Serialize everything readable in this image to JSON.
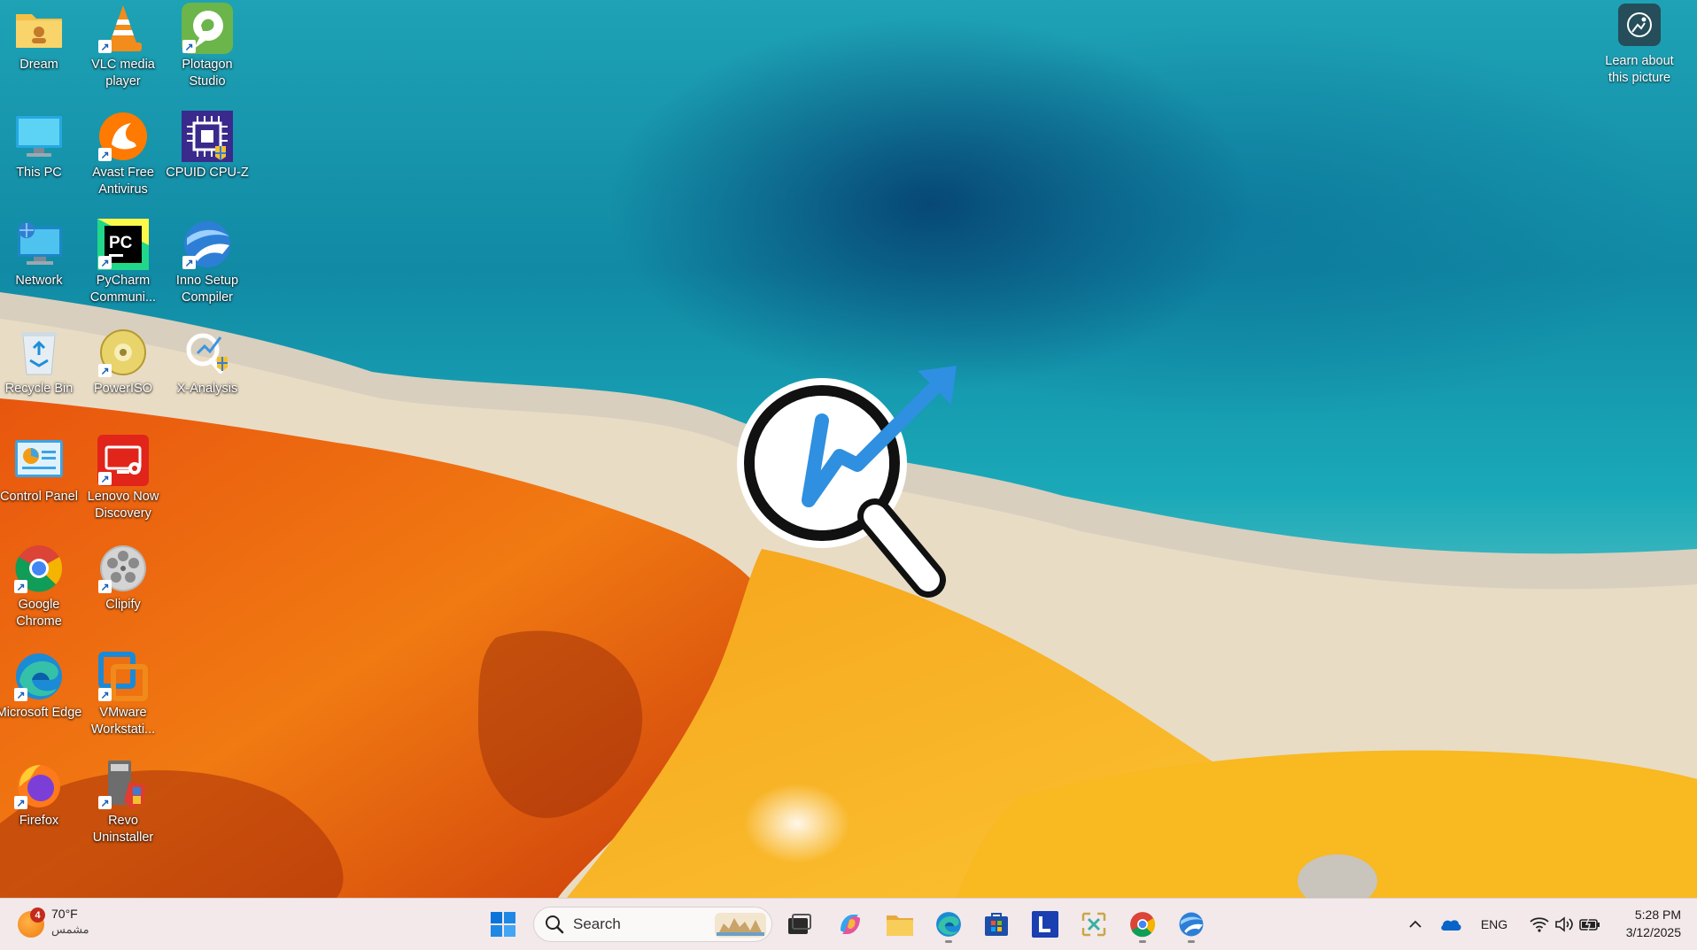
{
  "desktop": {
    "icons": [
      {
        "label": "Dream",
        "icon": "folder-icon"
      },
      {
        "label": "VLC media player",
        "icon": "vlc-icon"
      },
      {
        "label": "Plotagon Studio",
        "icon": "plotagon-icon"
      },
      {
        "label": "This PC",
        "icon": "monitor-icon"
      },
      {
        "label": "Avast Free Antivirus",
        "icon": "avast-icon"
      },
      {
        "label": "CPUID CPU-Z",
        "icon": "cpuz-icon"
      },
      {
        "label": "Network",
        "icon": "network-icon"
      },
      {
        "label": "PyCharm Communi...",
        "icon": "pycharm-icon"
      },
      {
        "label": "Inno Setup Compiler",
        "icon": "inno-setup-icon"
      },
      {
        "label": "Recycle Bin",
        "icon": "recycle-bin-icon"
      },
      {
        "label": "PowerISO",
        "icon": "poweriso-icon"
      },
      {
        "label": "X-Analysis",
        "icon": "x-analysis-icon"
      },
      {
        "label": "Control Panel",
        "icon": "control-panel-icon"
      },
      {
        "label": "Lenovo Now Discovery",
        "icon": "lenovo-now-icon"
      },
      {
        "label": "Google Chrome",
        "icon": "chrome-icon"
      },
      {
        "label": "Clipify",
        "icon": "clipify-icon"
      },
      {
        "label": "Microsoft Edge",
        "icon": "edge-icon"
      },
      {
        "label": "VMware Workstati...",
        "icon": "vmware-icon"
      },
      {
        "label": "Firefox",
        "icon": "firefox-icon"
      },
      {
        "label": "Revo Uninstaller",
        "icon": "revo-uninstaller-icon"
      }
    ],
    "learn_label": "Learn about this picture"
  },
  "taskbar": {
    "weather": {
      "badge": "4",
      "temp": "70°F",
      "condition": "مشمس"
    },
    "search_label": "Search",
    "apps": [
      "start",
      "search",
      "task-view",
      "copilot",
      "file-explorer",
      "edge",
      "microsoft-store",
      "lenovo-vantage",
      "snipping-tool",
      "chrome",
      "inno-setup"
    ],
    "tray": {
      "language": "ENG"
    },
    "clock": {
      "time": "5:28 PM",
      "date": "3/12/2025"
    }
  }
}
